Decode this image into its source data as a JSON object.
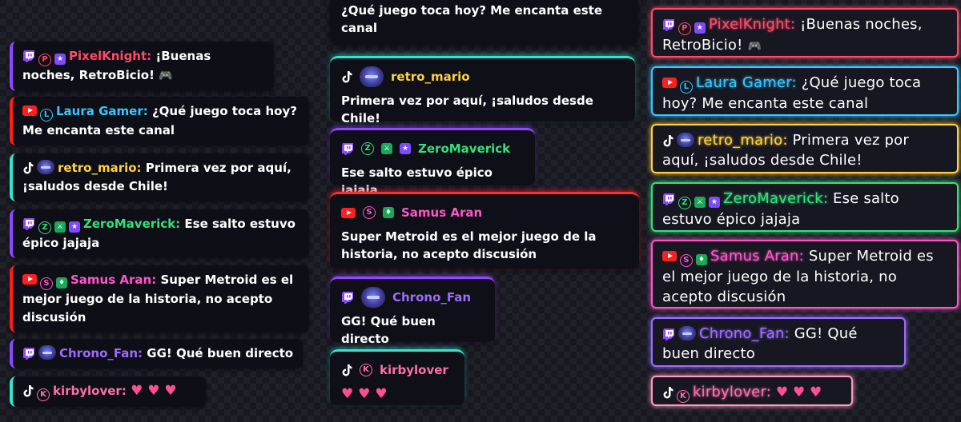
{
  "colors": {
    "twitch": "#9146ff",
    "youtube": "#ff1e1e",
    "tiktok": "#ffffff",
    "pixel": "#ff4a68",
    "laura": "#35c8ff",
    "retro": "#ffd23c",
    "zero": "#33e07a",
    "samus": "#ff55c8",
    "chrono": "#9b6cff",
    "kirby": "#ff6fa8"
  },
  "icons": {
    "twitch": "twitch-logo-icon",
    "youtube": "youtube-logo-icon",
    "tiktok": "tiktok-logo-icon",
    "partner": "circled-p-badge",
    "member": "circled-l-badge",
    "vip": "star-badge",
    "moderator": "sword-badge",
    "subscriber": "gem-badge",
    "emote": "gamepad-emote",
    "heart": "heart-emote"
  },
  "col_a": {
    "messages": [
      {
        "platform": "twitch",
        "user": "PixelKnight:",
        "text": "¡Buenas noches, RetroBicio!",
        "badges": [
          "P",
          "★"
        ],
        "emote": "🎮"
      },
      {
        "platform": "youtube",
        "user": "Laura Gamer:",
        "text": "¿Qué juego toca hoy? Me encanta este canal",
        "badges": [
          "L"
        ]
      },
      {
        "platform": "tiktok",
        "user": "retro_mario:",
        "text": "Primera vez por aquí, ¡saludos desde Chile!"
      },
      {
        "platform": "twitch",
        "user": "ZeroMaverick:",
        "text": "Ese salto estuvo épico jajaja",
        "badges": [
          "Z",
          "⚔",
          "★"
        ]
      },
      {
        "platform": "youtube",
        "user": "Samus Aran:",
        "text": "Super Metroid es el mejor juego de la historia, no acepto discusión",
        "badges": [
          "S",
          "♦"
        ]
      },
      {
        "platform": "twitch",
        "user": "Chrono_Fan:",
        "text": "GG! Qué buen directo"
      },
      {
        "platform": "tiktok",
        "user": "kirbylover:",
        "badges": [
          "K"
        ],
        "hearts": "♥ ♥ ♥"
      }
    ]
  },
  "col_b": {
    "messages": [
      {
        "text": "¿Qué juego toca hoy? Me encanta este canal"
      },
      {
        "platform": "tiktok",
        "user": "retro_mario",
        "text": "Primera vez por aquí, ¡saludos desde Chile!"
      },
      {
        "platform": "twitch",
        "user": "ZeroMaverick",
        "text": "Ese salto estuvo épico jajaja",
        "badges": [
          "Z",
          "⚔",
          "★"
        ]
      },
      {
        "platform": "youtube",
        "user": "Samus Aran",
        "text": "Super Metroid es el mejor juego de la historia, no acepto discusión",
        "badges": [
          "S",
          "♦"
        ]
      },
      {
        "platform": "twitch",
        "user": "Chrono_Fan",
        "text": "GG! Qué buen directo"
      },
      {
        "platform": "tiktok",
        "user": "kirbylover",
        "badges": [
          "K"
        ],
        "hearts": "♥ ♥ ♥"
      }
    ]
  },
  "col_c": {
    "messages": [
      {
        "platform": "twitch",
        "user": "PixelKnight:",
        "text": "¡Buenas noches, RetroBicio!",
        "badges": [
          "P",
          "★"
        ],
        "emote": "🎮"
      },
      {
        "platform": "youtube",
        "user": "Laura Gamer:",
        "text": "¿Qué juego toca hoy? Me encanta este canal",
        "badges": [
          "L"
        ]
      },
      {
        "platform": "tiktok",
        "user": "retro_mario:",
        "text": "Primera vez por aquí, ¡saludos desde Chile!"
      },
      {
        "platform": "twitch",
        "user": "ZeroMaverick:",
        "text": "Ese salto estuvo épico jajaja",
        "badges": [
          "Z",
          "⚔",
          "★"
        ]
      },
      {
        "platform": "youtube",
        "user": "Samus Aran:",
        "text": "Super Metroid es el mejor juego de la historia, no acepto discusión",
        "badges": [
          "S",
          "♦"
        ]
      },
      {
        "platform": "twitch",
        "user": "Chrono_Fan:",
        "text": "GG! Qué buen directo"
      },
      {
        "platform": "tiktok",
        "user": "kirbylover:",
        "badges": [
          "K"
        ],
        "hearts": "♥ ♥ ♥"
      }
    ]
  }
}
